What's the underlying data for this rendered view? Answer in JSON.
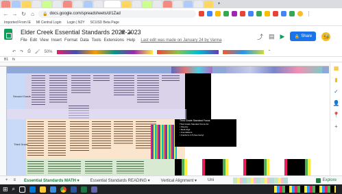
{
  "browser": {
    "url": "docs.google.com/spreadsheets/d/1Zad",
    "bookmarks": [
      "Imported From IE",
      "MI Central Login",
      "Login | N2Y",
      "SCUSD Beta Page"
    ]
  },
  "doc": {
    "title": "Elder Creek Essential Standards 2022-2023",
    "menu": [
      "File",
      "Edit",
      "View",
      "Insert",
      "Format",
      "Data",
      "Tools",
      "Extensions",
      "Help"
    ],
    "last_edit": "Last edit was made on January 24 by Vanna",
    "share_label": "Share",
    "zoom": "50%",
    "cell_ref": "B1"
  },
  "grid": {
    "row_labels": [
      "Second Grade",
      "Third Grade"
    ],
    "black_cell_title": "Third Grade Standard Focus",
    "black_cell_lines": [
      "Third Grade Standard Focus for:",
      "• Fluency",
      "• Multi-Digit",
      "• Foundations",
      "• Fractions 3-5 (Geometry)"
    ]
  },
  "sheet_tabs": {
    "add": "+",
    "list": "≡",
    "tabs": [
      "Essential Standards MATH ▾",
      "Essential Standards READING ▾",
      "Vertical Alignment ▾",
      "Uni"
    ],
    "explore": "Explore"
  },
  "colors": {
    "sheets_green": "#0f9d58",
    "share_blue": "#1a73e8",
    "header_blue": "#8fa8d8",
    "second_grade_fill": "#d9d2e9",
    "third_grade_fill": "#fce5cd",
    "taskbar": "#202124"
  }
}
